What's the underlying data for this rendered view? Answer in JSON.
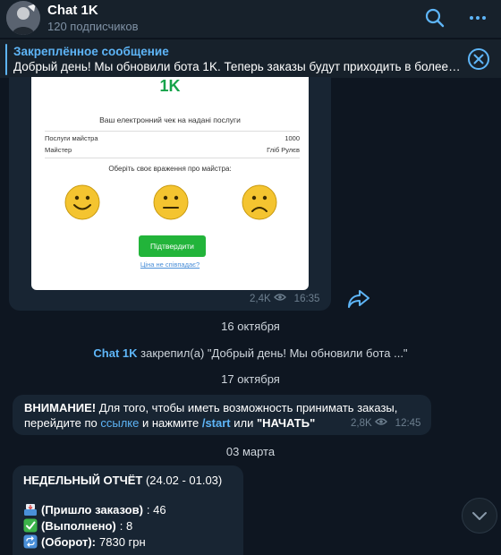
{
  "header": {
    "title": "Chat 1K",
    "subtitle": "120 подписчиков",
    "search_icon": "search-icon",
    "more_icon": "more-icon"
  },
  "pinned": {
    "title": "Закреплённое сообщение",
    "text": "Добрый день! Мы обновили бота 1K. Теперь заказы будут приходить в более…"
  },
  "receipt": {
    "logo": "1K",
    "title": "Ваш електронний чек на надані послуги",
    "rows": [
      {
        "label": "Послуги майстра",
        "value": "1000"
      },
      {
        "label": "Майстер",
        "value": "Гліб Рулєв"
      }
    ],
    "rate_prompt": "Оберіть своє враження про майстра:",
    "confirm_button": "Підтвердити",
    "price_link": "Ціна не співпадає?"
  },
  "receipt_meta": {
    "views": "2,4K",
    "time": "16:35"
  },
  "date_1": "16 октября",
  "service": {
    "actor": "Chat 1K",
    "text": " закрепил(а) \"Добрый день! Мы обновили бота ...\""
  },
  "date_2": "17 октября",
  "message_2": {
    "bold_1": "ВНИМАНИЕ!",
    "text_1": " Для того, чтобы иметь возможность принимать заказы,",
    "text_2": "перейдите по ",
    "link": "ссылке",
    "text_3": " и нажмите ",
    "command": "/start",
    "text_4": " или ",
    "bold_2": "\"НАЧАТЬ\"",
    "views": "2,8K",
    "time": "12:45"
  },
  "date_3": "03 марта",
  "message_3": {
    "title_bold": "НЕДЕЛЬНЫЙ ОТЧЁТ",
    "title_range": " (24.02 - 01.03)",
    "rows": [
      {
        "label": "(Пришло заказов)",
        "value": " : 46"
      },
      {
        "label": "(Выполнено)",
        "value": " : 8"
      },
      {
        "label": "(Оборот):",
        "value": " 7830 грн"
      }
    ]
  },
  "colors": {
    "background": "#0e1621",
    "panel": "#17212b",
    "bubble": "#182533",
    "accent": "#5eb5f7",
    "meta": "#6d7f8f"
  }
}
